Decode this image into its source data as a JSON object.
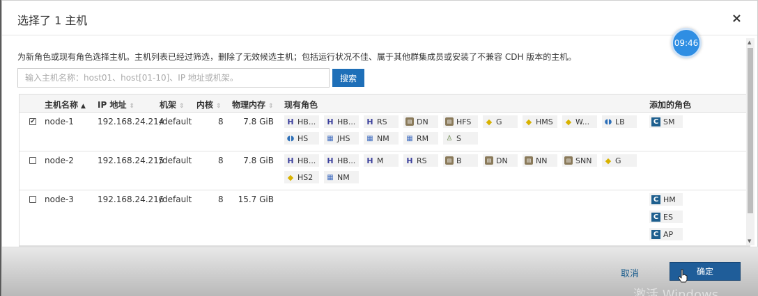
{
  "dialog": {
    "title": "选择了 1 主机",
    "close": "×",
    "clock": "09:46",
    "description": "为新角色或现有角色选择主机。主机列表已经过筛选，删除了无效候选主机；包括运行状况不佳、属于其他群集成员或安装了不兼容 CDH 版本的主机。",
    "search_placeholder": "输入主机名称：host01、host[01-10]、IP 地址或机架。",
    "search_button": "搜索"
  },
  "table": {
    "headers": {
      "hostname": "主机名称",
      "ip": "IP 地址",
      "rack": "机架",
      "cores": "内核",
      "memory": "物理内存",
      "roles": "现有角色",
      "added": "添加的角色"
    },
    "rows": [
      {
        "checked": "✔",
        "hostname": "node-1",
        "ip": "192.168.24.214",
        "rack": "/default",
        "cores": "8",
        "memory": "7.8 GiB",
        "roles": [
          {
            "icon": "hbase-icon",
            "label": "HB..."
          },
          {
            "icon": "hbase-icon",
            "label": "HB..."
          },
          {
            "icon": "hbase-icon",
            "label": "RS"
          },
          {
            "icon": "hdfs-icon",
            "label": "DN"
          },
          {
            "icon": "hdfs-icon",
            "label": "HFS"
          },
          {
            "icon": "hive-icon",
            "label": "G"
          },
          {
            "icon": "hive-icon",
            "label": "HMS"
          },
          {
            "icon": "hive-icon",
            "label": "W..."
          },
          {
            "icon": "hue-icon",
            "label": "LB"
          },
          {
            "icon": "hue-icon",
            "label": "HS"
          },
          {
            "icon": "yarn-icon",
            "label": "JHS"
          },
          {
            "icon": "yarn-icon",
            "label": "NM"
          },
          {
            "icon": "yarn-icon",
            "label": "RM"
          },
          {
            "icon": "sqoop-icon",
            "label": "S"
          }
        ],
        "added": [
          {
            "label": "SM"
          }
        ]
      },
      {
        "checked": "",
        "hostname": "node-2",
        "ip": "192.168.24.215",
        "rack": "/default",
        "cores": "8",
        "memory": "7.8 GiB",
        "roles": [
          {
            "icon": "hbase-icon",
            "label": "HB..."
          },
          {
            "icon": "hbase-icon",
            "label": "HB..."
          },
          {
            "icon": "hbase-icon",
            "label": "M"
          },
          {
            "icon": "hbase-icon",
            "label": "RS"
          },
          {
            "icon": "hdfs-icon",
            "label": "B"
          },
          {
            "icon": "hdfs-icon",
            "label": "DN"
          },
          {
            "icon": "hdfs-icon",
            "label": "NN"
          },
          {
            "icon": "hdfs-icon",
            "label": "SNN"
          },
          {
            "icon": "hive-icon",
            "label": "G"
          },
          {
            "icon": "hive-icon",
            "label": "HS2"
          },
          {
            "icon": "yarn-icon",
            "label": "NM"
          }
        ],
        "added": []
      },
      {
        "checked": "",
        "hostname": "node-3",
        "ip": "192.168.24.216",
        "rack": "/default",
        "cores": "8",
        "memory": "15.7 GiB",
        "roles": [],
        "added": [
          {
            "label": "HM"
          },
          {
            "label": "ES"
          },
          {
            "label": "AP"
          }
        ]
      }
    ]
  },
  "footer": {
    "cancel": "取消",
    "ok": "确定",
    "watermark": "激活 Windows"
  }
}
